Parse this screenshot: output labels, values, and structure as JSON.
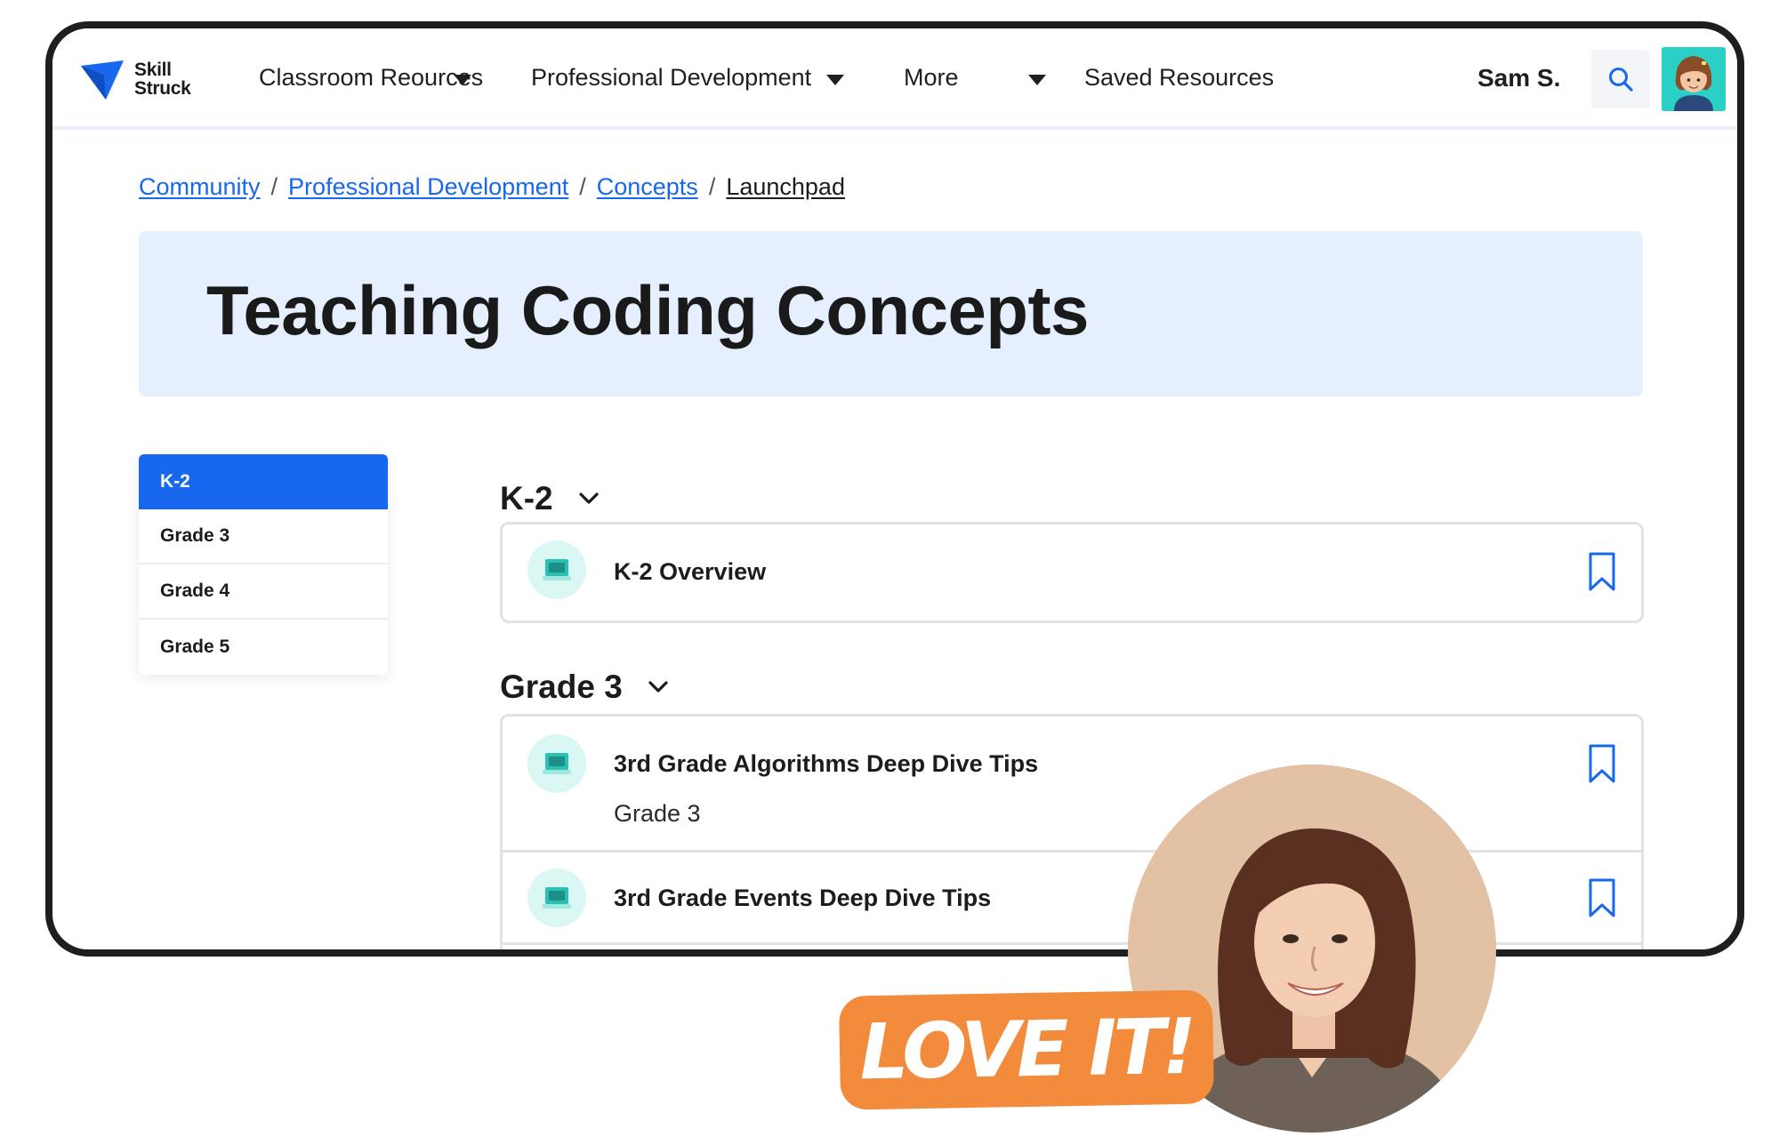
{
  "brand": {
    "line1": "Skill",
    "line2": "Struck",
    "accent": "#1768ef"
  },
  "nav": {
    "items": [
      {
        "label": "Classroom Reources",
        "has_dropdown": true
      },
      {
        "label": "Professional Development",
        "has_dropdown": true
      },
      {
        "label": "More",
        "has_dropdown": true
      },
      {
        "label": "Saved Resources",
        "has_dropdown": false
      }
    ],
    "user": "Sam S.",
    "search_icon": "search-icon",
    "avatar_icon": "user-avatar"
  },
  "breadcrumb": {
    "links": [
      "Community",
      "Professional Development",
      "Concepts"
    ],
    "separator": "/",
    "current": "Launchpad"
  },
  "hero": {
    "title": "Teaching Coding Concepts",
    "background": "#e6effd"
  },
  "grade_menu": {
    "items": [
      "K-2",
      "Grade 3",
      "Grade 4",
      "Grade 5"
    ],
    "selected": "K-2"
  },
  "sections": [
    {
      "title": "K-2",
      "rows": [
        {
          "title": "K-2 Overview",
          "subtitle": "",
          "icon": "computer-icon"
        }
      ]
    },
    {
      "title": "Grade 3",
      "rows": [
        {
          "title": "3rd Grade Algorithms Deep Dive Tips",
          "subtitle": "Grade 3",
          "icon": "computer-icon"
        },
        {
          "title": "3rd Grade Events Deep Dive Tips",
          "subtitle": "",
          "icon": "computer-icon"
        }
      ]
    }
  ],
  "overlay": {
    "badge": "LOVE IT!",
    "badge_color": "#f28b3c"
  }
}
